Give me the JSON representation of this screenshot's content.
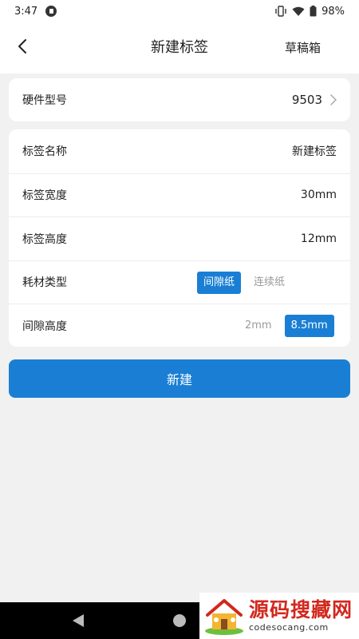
{
  "status_bar": {
    "time": "3:47",
    "battery": "98%"
  },
  "header": {
    "title": "新建标签",
    "drafts_label": "草稿箱"
  },
  "hardware": {
    "label": "硬件型号",
    "value": "9503"
  },
  "form": {
    "name": {
      "label": "标签名称",
      "value": "新建标签"
    },
    "width": {
      "label": "标签宽度",
      "value": "30mm"
    },
    "height": {
      "label": "标签高度",
      "value": "12mm"
    },
    "consumable": {
      "label": "耗材类型",
      "options": [
        "间隙纸",
        "连续纸"
      ],
      "selected": "间隙纸"
    },
    "gap_height": {
      "label": "间隙高度",
      "options": [
        "2mm",
        "8.5mm"
      ],
      "selected": "8.5mm"
    }
  },
  "create_button": "新建",
  "watermark": {
    "title": "源码搜藏网",
    "url": "codesocang.com"
  },
  "colors": {
    "accent": "#1a7fd4",
    "background": "#f1f1f1",
    "watermark_red": "#d2281e"
  },
  "icons": [
    "back-arrow-icon",
    "chevron-right-icon",
    "vibrate-icon",
    "wifi-icon",
    "battery-icon",
    "nav-back-icon",
    "nav-home-icon"
  ]
}
